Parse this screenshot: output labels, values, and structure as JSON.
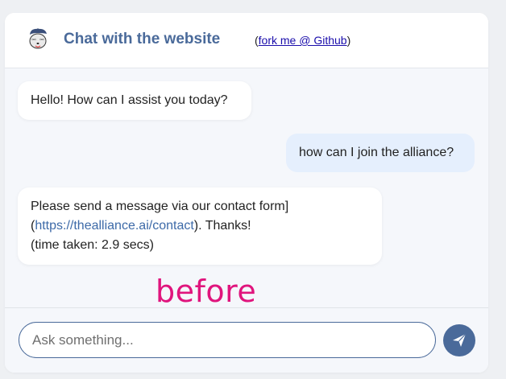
{
  "header": {
    "title": "Chat with the website",
    "fork_prefix": "(",
    "fork_link": "fork me @ Github",
    "fork_suffix": ")",
    "logo_icon": "raccoon-mascot-icon"
  },
  "messages": [
    {
      "role": "assistant",
      "text": "Hello! How can I assist you today?"
    },
    {
      "role": "user",
      "text": "how can I join the alliance?"
    },
    {
      "role": "assistant",
      "line1": "Please send a message via our contact form]",
      "line2_prefix": "(",
      "line2_link": "https://thealliance.ai/contact",
      "line2_suffix": "). Thanks!",
      "line3": "(time taken: 2.9 secs)"
    }
  ],
  "annotation": "before",
  "input": {
    "placeholder": "Ask something...",
    "value": ""
  },
  "send_icon": "paper-plane-icon",
  "colors": {
    "accent": "#4a6a9a",
    "user_bubble": "#e5effd",
    "link": "#3d6aa8",
    "annotation": "#e0157d",
    "chat_background": "#f5f7fb"
  }
}
